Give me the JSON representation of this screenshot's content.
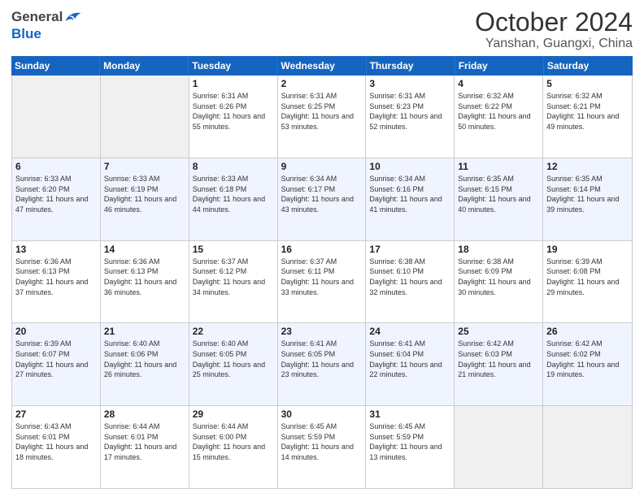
{
  "header": {
    "logo": {
      "line1": "General",
      "line2": "Blue"
    },
    "month_title": "October 2024",
    "location": "Yanshan, Guangxi, China"
  },
  "days_of_week": [
    "Sunday",
    "Monday",
    "Tuesday",
    "Wednesday",
    "Thursday",
    "Friday",
    "Saturday"
  ],
  "weeks": [
    [
      {
        "day": "",
        "empty": true
      },
      {
        "day": "",
        "empty": true
      },
      {
        "day": "1",
        "sunrise": "Sunrise: 6:31 AM",
        "sunset": "Sunset: 6:26 PM",
        "daylight": "Daylight: 11 hours and 55 minutes."
      },
      {
        "day": "2",
        "sunrise": "Sunrise: 6:31 AM",
        "sunset": "Sunset: 6:25 PM",
        "daylight": "Daylight: 11 hours and 53 minutes."
      },
      {
        "day": "3",
        "sunrise": "Sunrise: 6:31 AM",
        "sunset": "Sunset: 6:23 PM",
        "daylight": "Daylight: 11 hours and 52 minutes."
      },
      {
        "day": "4",
        "sunrise": "Sunrise: 6:32 AM",
        "sunset": "Sunset: 6:22 PM",
        "daylight": "Daylight: 11 hours and 50 minutes."
      },
      {
        "day": "5",
        "sunrise": "Sunrise: 6:32 AM",
        "sunset": "Sunset: 6:21 PM",
        "daylight": "Daylight: 11 hours and 49 minutes."
      }
    ],
    [
      {
        "day": "6",
        "sunrise": "Sunrise: 6:33 AM",
        "sunset": "Sunset: 6:20 PM",
        "daylight": "Daylight: 11 hours and 47 minutes."
      },
      {
        "day": "7",
        "sunrise": "Sunrise: 6:33 AM",
        "sunset": "Sunset: 6:19 PM",
        "daylight": "Daylight: 11 hours and 46 minutes."
      },
      {
        "day": "8",
        "sunrise": "Sunrise: 6:33 AM",
        "sunset": "Sunset: 6:18 PM",
        "daylight": "Daylight: 11 hours and 44 minutes."
      },
      {
        "day": "9",
        "sunrise": "Sunrise: 6:34 AM",
        "sunset": "Sunset: 6:17 PM",
        "daylight": "Daylight: 11 hours and 43 minutes."
      },
      {
        "day": "10",
        "sunrise": "Sunrise: 6:34 AM",
        "sunset": "Sunset: 6:16 PM",
        "daylight": "Daylight: 11 hours and 41 minutes."
      },
      {
        "day": "11",
        "sunrise": "Sunrise: 6:35 AM",
        "sunset": "Sunset: 6:15 PM",
        "daylight": "Daylight: 11 hours and 40 minutes."
      },
      {
        "day": "12",
        "sunrise": "Sunrise: 6:35 AM",
        "sunset": "Sunset: 6:14 PM",
        "daylight": "Daylight: 11 hours and 39 minutes."
      }
    ],
    [
      {
        "day": "13",
        "sunrise": "Sunrise: 6:36 AM",
        "sunset": "Sunset: 6:13 PM",
        "daylight": "Daylight: 11 hours and 37 minutes."
      },
      {
        "day": "14",
        "sunrise": "Sunrise: 6:36 AM",
        "sunset": "Sunset: 6:13 PM",
        "daylight": "Daylight: 11 hours and 36 minutes."
      },
      {
        "day": "15",
        "sunrise": "Sunrise: 6:37 AM",
        "sunset": "Sunset: 6:12 PM",
        "daylight": "Daylight: 11 hours and 34 minutes."
      },
      {
        "day": "16",
        "sunrise": "Sunrise: 6:37 AM",
        "sunset": "Sunset: 6:11 PM",
        "daylight": "Daylight: 11 hours and 33 minutes."
      },
      {
        "day": "17",
        "sunrise": "Sunrise: 6:38 AM",
        "sunset": "Sunset: 6:10 PM",
        "daylight": "Daylight: 11 hours and 32 minutes."
      },
      {
        "day": "18",
        "sunrise": "Sunrise: 6:38 AM",
        "sunset": "Sunset: 6:09 PM",
        "daylight": "Daylight: 11 hours and 30 minutes."
      },
      {
        "day": "19",
        "sunrise": "Sunrise: 6:39 AM",
        "sunset": "Sunset: 6:08 PM",
        "daylight": "Daylight: 11 hours and 29 minutes."
      }
    ],
    [
      {
        "day": "20",
        "sunrise": "Sunrise: 6:39 AM",
        "sunset": "Sunset: 6:07 PM",
        "daylight": "Daylight: 11 hours and 27 minutes."
      },
      {
        "day": "21",
        "sunrise": "Sunrise: 6:40 AM",
        "sunset": "Sunset: 6:06 PM",
        "daylight": "Daylight: 11 hours and 26 minutes."
      },
      {
        "day": "22",
        "sunrise": "Sunrise: 6:40 AM",
        "sunset": "Sunset: 6:05 PM",
        "daylight": "Daylight: 11 hours and 25 minutes."
      },
      {
        "day": "23",
        "sunrise": "Sunrise: 6:41 AM",
        "sunset": "Sunset: 6:05 PM",
        "daylight": "Daylight: 11 hours and 23 minutes."
      },
      {
        "day": "24",
        "sunrise": "Sunrise: 6:41 AM",
        "sunset": "Sunset: 6:04 PM",
        "daylight": "Daylight: 11 hours and 22 minutes."
      },
      {
        "day": "25",
        "sunrise": "Sunrise: 6:42 AM",
        "sunset": "Sunset: 6:03 PM",
        "daylight": "Daylight: 11 hours and 21 minutes."
      },
      {
        "day": "26",
        "sunrise": "Sunrise: 6:42 AM",
        "sunset": "Sunset: 6:02 PM",
        "daylight": "Daylight: 11 hours and 19 minutes."
      }
    ],
    [
      {
        "day": "27",
        "sunrise": "Sunrise: 6:43 AM",
        "sunset": "Sunset: 6:01 PM",
        "daylight": "Daylight: 11 hours and 18 minutes."
      },
      {
        "day": "28",
        "sunrise": "Sunrise: 6:44 AM",
        "sunset": "Sunset: 6:01 PM",
        "daylight": "Daylight: 11 hours and 17 minutes."
      },
      {
        "day": "29",
        "sunrise": "Sunrise: 6:44 AM",
        "sunset": "Sunset: 6:00 PM",
        "daylight": "Daylight: 11 hours and 15 minutes."
      },
      {
        "day": "30",
        "sunrise": "Sunrise: 6:45 AM",
        "sunset": "Sunset: 5:59 PM",
        "daylight": "Daylight: 11 hours and 14 minutes."
      },
      {
        "day": "31",
        "sunrise": "Sunrise: 6:45 AM",
        "sunset": "Sunset: 5:59 PM",
        "daylight": "Daylight: 11 hours and 13 minutes."
      },
      {
        "day": "",
        "empty": true
      },
      {
        "day": "",
        "empty": true
      }
    ]
  ]
}
